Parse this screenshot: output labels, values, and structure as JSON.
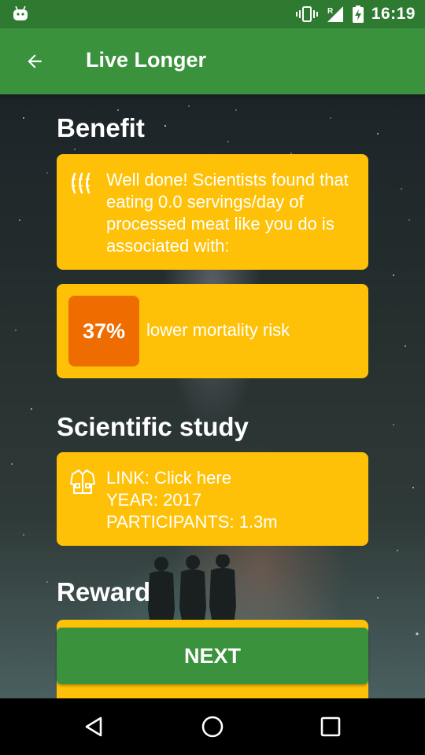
{
  "status_bar": {
    "time": "16:19",
    "icons": [
      "android-icon",
      "vibrate-icon",
      "signal-roaming-icon",
      "battery-charging-icon"
    ]
  },
  "app_bar": {
    "title": "Live Longer",
    "back_icon": "arrow-back-icon"
  },
  "benefit": {
    "heading": "Benefit",
    "message_icon": "sausage-icon",
    "message": "Well done! Scientists found that eating 0.0 servings/day of processed meat like you do is associated with:",
    "percent": "37%",
    "result": "lower mortality risk"
  },
  "study": {
    "heading": "Scientific study",
    "icon": "lab-coat-icon",
    "link": "LINK: Click here",
    "year": "YEAR: 2017",
    "participants": "PARTICIPANTS: 1.3m"
  },
  "reward": {
    "heading": "Reward"
  },
  "next_button": {
    "label": "NEXT"
  },
  "colors": {
    "status_bar": "#2f7a31",
    "app_bar": "#3a923d",
    "card": "#fec107",
    "percent_box": "#ef6c00",
    "button": "#3a923d"
  },
  "nav_bar": {
    "icons": [
      "back-triangle-icon",
      "home-circle-icon",
      "recents-square-icon"
    ]
  }
}
